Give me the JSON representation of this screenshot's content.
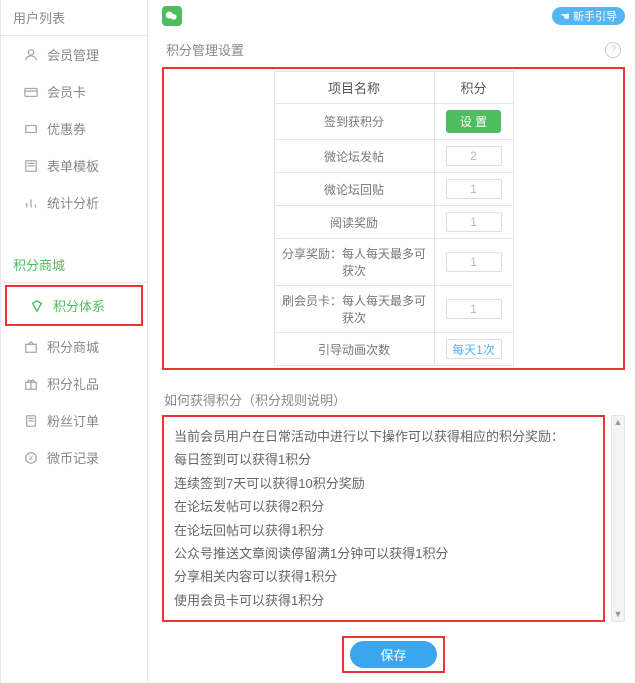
{
  "sidebar": {
    "section_user": "用户列表",
    "items_user": [
      {
        "label": "会员管理"
      },
      {
        "label": "会员卡"
      },
      {
        "label": "优惠券"
      },
      {
        "label": "表单模板"
      },
      {
        "label": "统计分析"
      }
    ],
    "section_mall": "积分商城",
    "items_mall": [
      {
        "label": "积分体系"
      },
      {
        "label": "积分商城"
      },
      {
        "label": "积分礼品"
      },
      {
        "label": "粉丝订单"
      },
      {
        "label": "微币记录"
      }
    ]
  },
  "topbar": {
    "guide": "新手引导"
  },
  "panel_title": "积分管理设置",
  "table": {
    "col_name": "项目名称",
    "col_points": "积分",
    "rows": [
      {
        "name": "签到获积分"
      },
      {
        "name": "微论坛发帖",
        "value": "2"
      },
      {
        "name": "微论坛回贴",
        "value": "1"
      },
      {
        "name": "阅读奖励",
        "value": "1"
      },
      {
        "name": "分享奖励：每人每天最多可获次",
        "value": "1"
      },
      {
        "name": "刷会员卡：每人每天最多可获次",
        "value": "1"
      },
      {
        "name": "引导动画次数",
        "value": "每天1次"
      }
    ],
    "setup_btn": "设 置"
  },
  "rules_title": "如何获得积分（积分规则说明）",
  "rules_lines": [
    "当前会员用户在日常活动中进行以下操作可以获得相应的积分奖励：",
    "每日签到可以获得1积分",
    "连续签到7天可以获得10积分奖励",
    "在论坛发帖可以获得2积分",
    "在论坛回帖可以获得1积分",
    "公众号推送文章阅读停留满1分钟可以获得1积分",
    "分享相关内容可以获得1积分",
    "使用会员卡可以获得1积分"
  ],
  "save_btn": "保存"
}
